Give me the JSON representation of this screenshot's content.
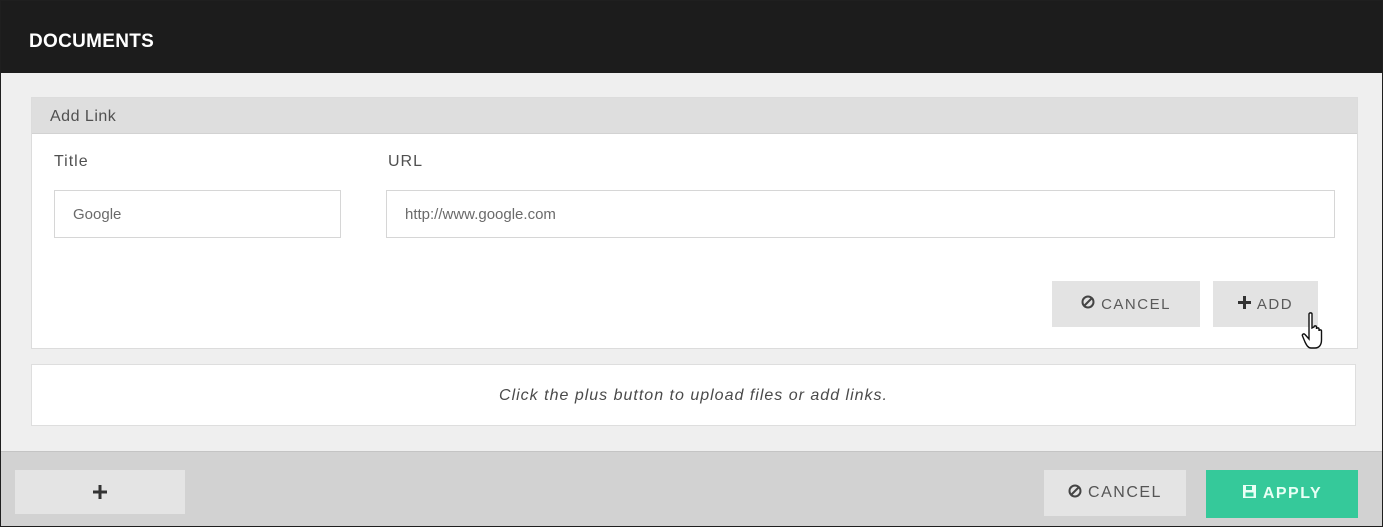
{
  "window": {
    "title": "DOCUMENTS"
  },
  "add_link": {
    "header": "Add Link",
    "title_label": "Title",
    "url_label": "URL",
    "title_value": "Google",
    "url_value": "http://www.google.com",
    "cancel_label": "CANCEL",
    "add_label": "ADD",
    "cancel_icon": "ban-icon",
    "add_icon": "plus-icon"
  },
  "info": {
    "message": "Click the plus button to upload files or add links."
  },
  "footer": {
    "plus_icon": "plus-icon",
    "cancel_label": "CANCEL",
    "apply_label": "APPLY",
    "apply_icon": "save-icon"
  },
  "colors": {
    "titlebar": "#1c1c1c",
    "apply_button": "#35c99a",
    "footer": "#d2d2d2"
  }
}
